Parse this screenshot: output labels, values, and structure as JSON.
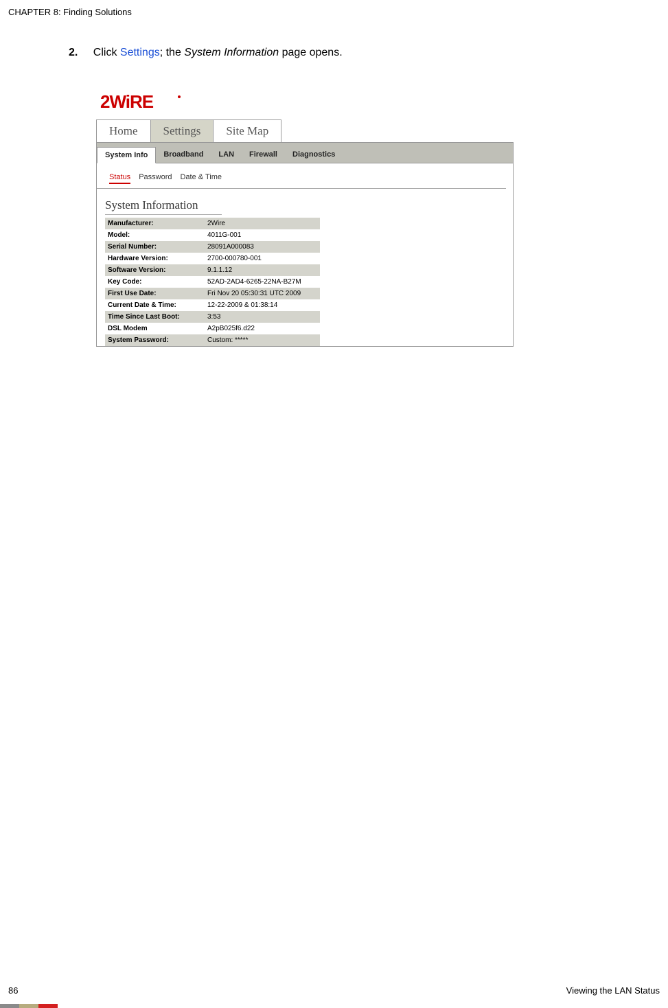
{
  "header": {
    "chapter": "CHAPTER 8: Finding Solutions"
  },
  "step": {
    "number": "2.",
    "pre": "Click ",
    "link": "Settings",
    "mid": "; the ",
    "italic": "System Information",
    "post": " page opens."
  },
  "logo": {
    "brand": "2WiRE",
    "reg": "®"
  },
  "mainTabs": {
    "t0": "Home",
    "t1": "Settings",
    "t2": "Site Map"
  },
  "secTabs": {
    "t0": "System Info",
    "t1": "Broadband",
    "t2": "LAN",
    "t3": "Firewall",
    "t4": "Diagnostics"
  },
  "innerLinks": {
    "l0": "Status",
    "l1": "Password",
    "l2": "Date & Time"
  },
  "sectionTitle": "System Information",
  "rows": [
    {
      "label": "Manufacturer:",
      "value": "2Wire"
    },
    {
      "label": "Model:",
      "value": "4011G-001"
    },
    {
      "label": "Serial Number:",
      "value": "28091A000083"
    },
    {
      "label": "Hardware Version:",
      "value": "2700-000780-001"
    },
    {
      "label": "Software Version:",
      "value": "9.1.1.12"
    },
    {
      "label": "Key Code:",
      "value": "52AD-2AD4-6265-22NA-B27M"
    },
    {
      "label": "First Use Date:",
      "value": "Fri Nov 20 05:30:31 UTC 2009"
    },
    {
      "label": "Current Date & Time:",
      "value": "12-22-2009 & 01:38:14"
    },
    {
      "label": "Time Since Last Boot:",
      "value": "3:53"
    },
    {
      "label": "DSL Modem",
      "value": "A2pB025f6.d22"
    },
    {
      "label": "System Password:",
      "value": "Custom: *****"
    }
  ],
  "footer": {
    "pageNum": "86",
    "rightText": "Viewing the LAN Status"
  }
}
